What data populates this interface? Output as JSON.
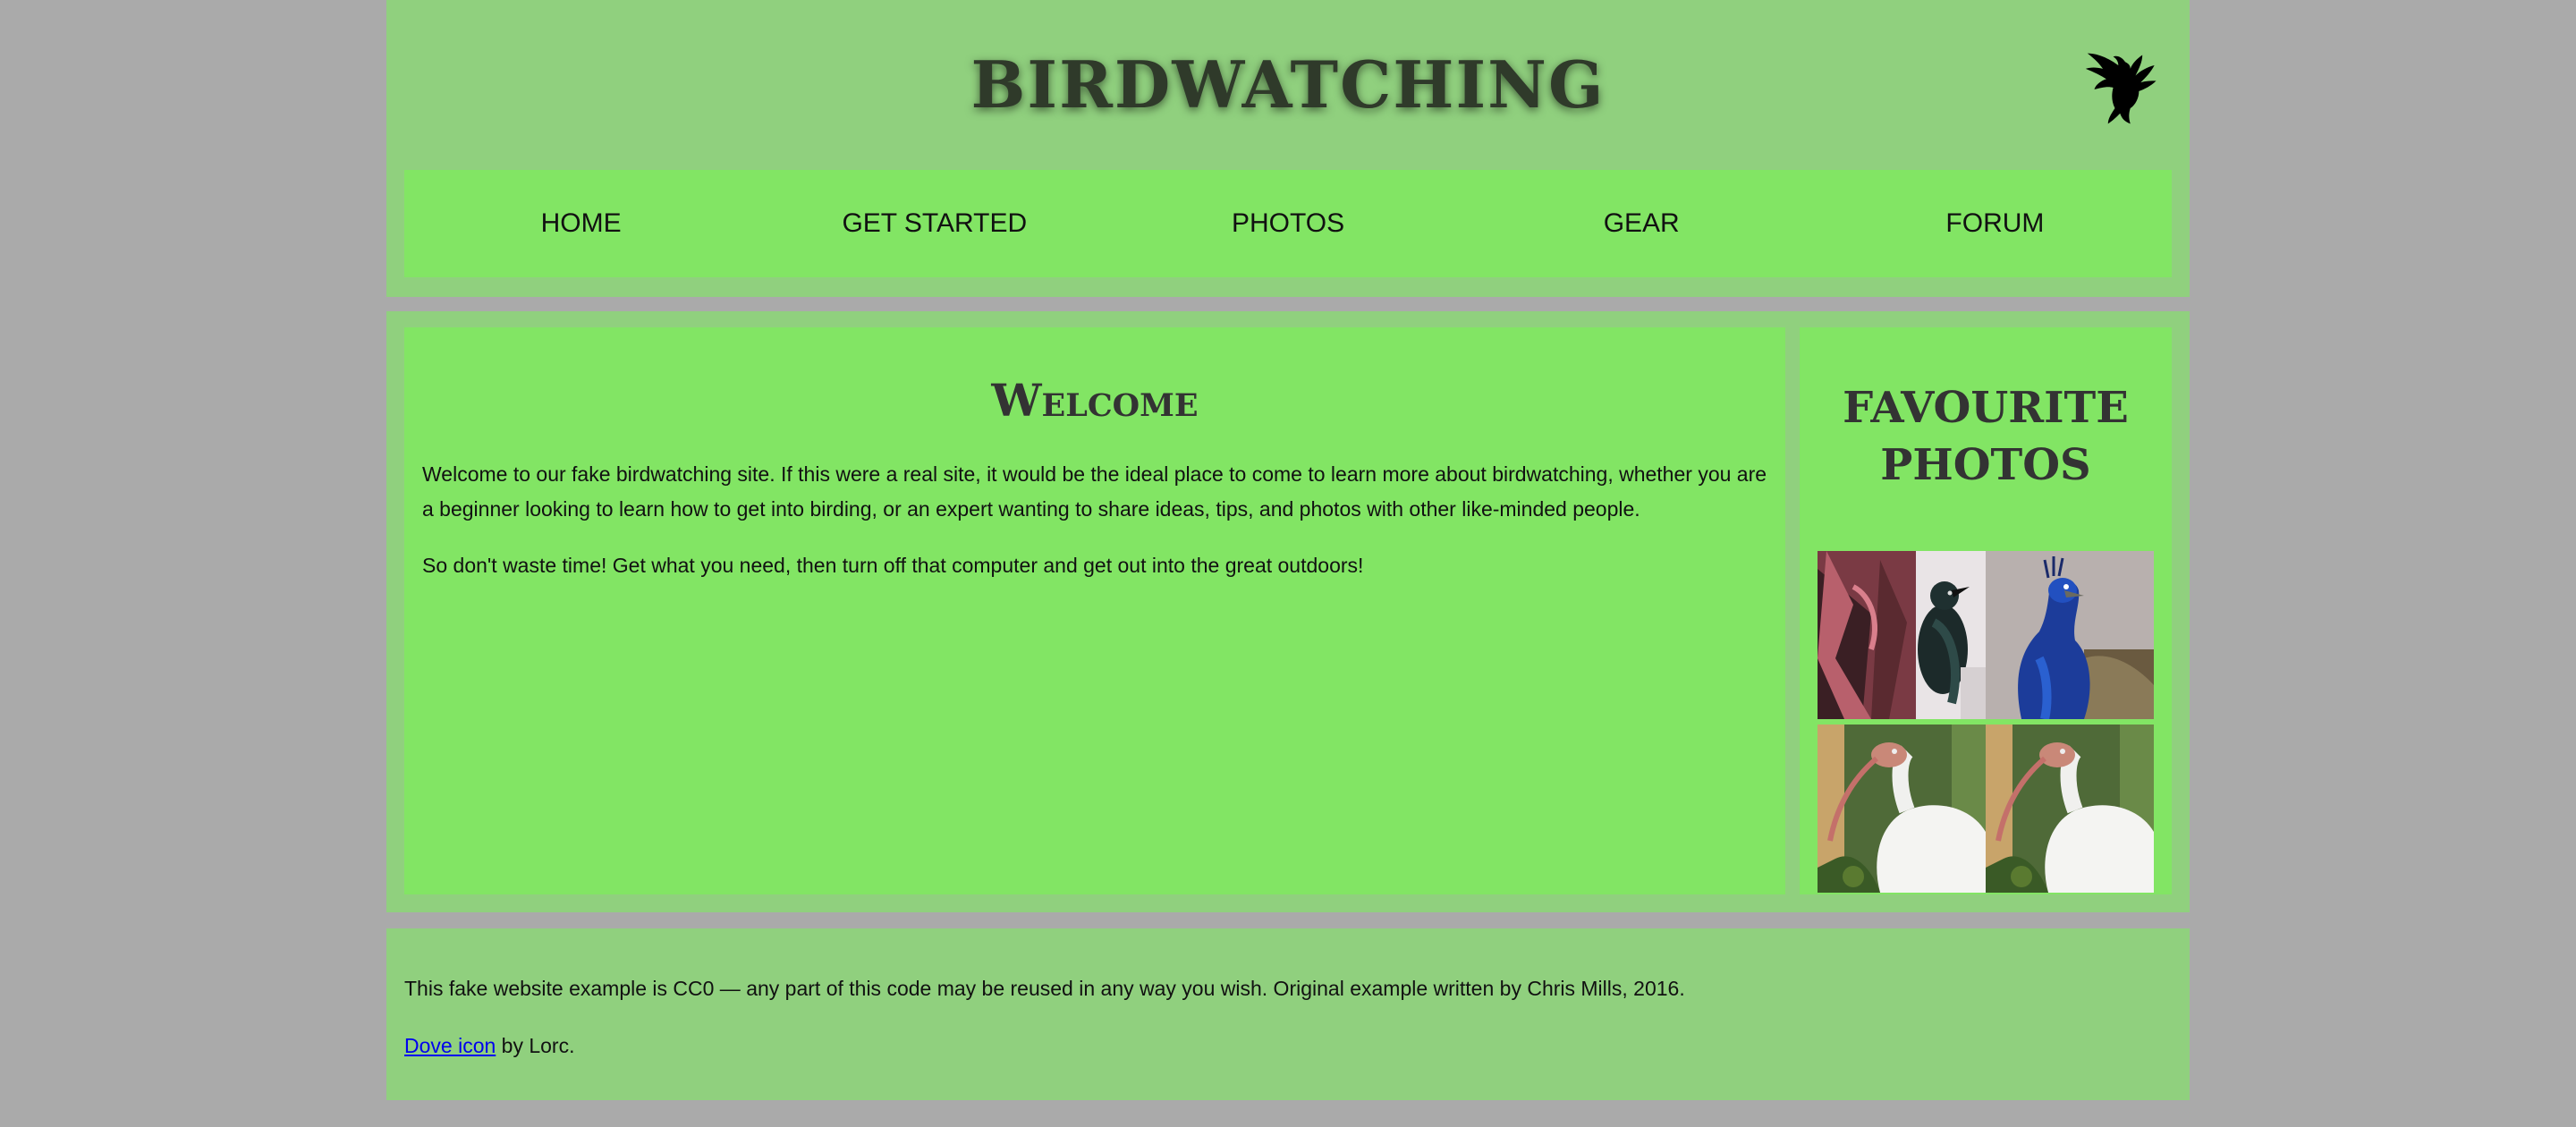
{
  "header": {
    "title": "Birdwatching",
    "logo_icon": "dove-icon"
  },
  "nav": {
    "items": [
      {
        "label": "HOME"
      },
      {
        "label": "GET STARTED"
      },
      {
        "label": "PHOTOS"
      },
      {
        "label": "GEAR"
      },
      {
        "label": "FORUM"
      }
    ]
  },
  "main": {
    "heading": "Welcome",
    "paragraphs": [
      "Welcome to our fake birdwatching site. If this were a real site, it would be the ideal place to come to learn more about birdwatching, whether you are a beginner looking to learn how to get into birding, or an expert wanting to share ideas, tips, and photos with other like-minded people.",
      "So don't waste time! Get what you need, then turn off that computer and get out into the great outdoors!"
    ]
  },
  "aside": {
    "heading": "Favourite photos",
    "photos": [
      {
        "subject": "tui-bird-photo"
      },
      {
        "subject": "peacock-photo"
      },
      {
        "subject": "white-ibis-photo"
      },
      {
        "subject": "white-ibis-photo"
      }
    ]
  },
  "footer": {
    "license_text": "This fake website example is CC0 — any part of this code may be reused in any way you wish. Original example written by Chris Mills, 2016.",
    "credit_link": "Dove icon",
    "credit_suffix": " by Lorc."
  },
  "colors": {
    "page_background": "#aaaaaa",
    "section_background": "#90d07e",
    "panel_background": "#82e564",
    "link": "#0000ee"
  }
}
